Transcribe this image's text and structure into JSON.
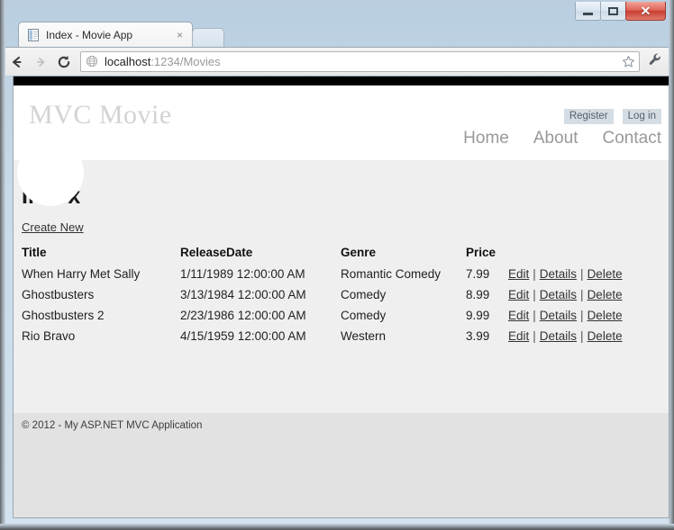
{
  "window": {
    "minimize_label": "–",
    "maximize_label": "❐",
    "close_label": "✕"
  },
  "browser": {
    "tab": {
      "title": "Index - Movie App",
      "close_label": "×",
      "favicon": "page-favicon"
    },
    "toolbar": {
      "back_icon": "back-arrow-icon",
      "forward_icon": "forward-arrow-icon",
      "reload_icon": "reload-icon",
      "bookmark_icon": "star-icon",
      "menu_icon": "wrench-icon",
      "omnibox": {
        "site_icon": "globe-icon",
        "url_domain": "localhost",
        "url_path": ":1234/Movies",
        "full_url": "localhost:1234/Movies"
      }
    }
  },
  "page": {
    "brand": "MVC Movie",
    "auth": [
      {
        "label": "Register",
        "name": "register-link"
      },
      {
        "label": "Log in",
        "name": "login-link"
      }
    ],
    "nav": [
      {
        "label": "Home",
        "name": "nav-home"
      },
      {
        "label": "About",
        "name": "nav-about"
      },
      {
        "label": "Contact",
        "name": "nav-contact"
      }
    ],
    "title": "Index",
    "create_link": "Create New",
    "table": {
      "headers": [
        "Title",
        "ReleaseDate",
        "Genre",
        "Price"
      ],
      "action_labels": {
        "edit": "Edit",
        "details": "Details",
        "delete": "Delete",
        "separator": "|"
      },
      "rows": [
        {
          "title": "When Harry Met Sally",
          "release_date": "1/11/1989 12:00:00 AM",
          "genre": "Romantic Comedy",
          "price": "7.99"
        },
        {
          "title": "Ghostbusters",
          "release_date": "3/13/1984 12:00:00 AM",
          "genre": "Comedy",
          "price": "8.99"
        },
        {
          "title": "Ghostbusters 2",
          "release_date": "2/23/1986 12:00:00 AM",
          "genre": "Comedy",
          "price": "9.99"
        },
        {
          "title": "Rio Bravo",
          "release_date": "4/15/1959 12:00:00 AM",
          "genre": "Western",
          "price": "3.99"
        }
      ]
    },
    "footer": "© 2012 - My ASP.NET MVC Application"
  },
  "colors": {
    "brand_text": "#d3d3d3",
    "nav_text": "#999999",
    "auth_bg": "#d5dde4",
    "content_bg": "#efefef",
    "footer_bg": "#e2e2e2",
    "top_bar": "#000000",
    "close_button": "#c93f32"
  }
}
